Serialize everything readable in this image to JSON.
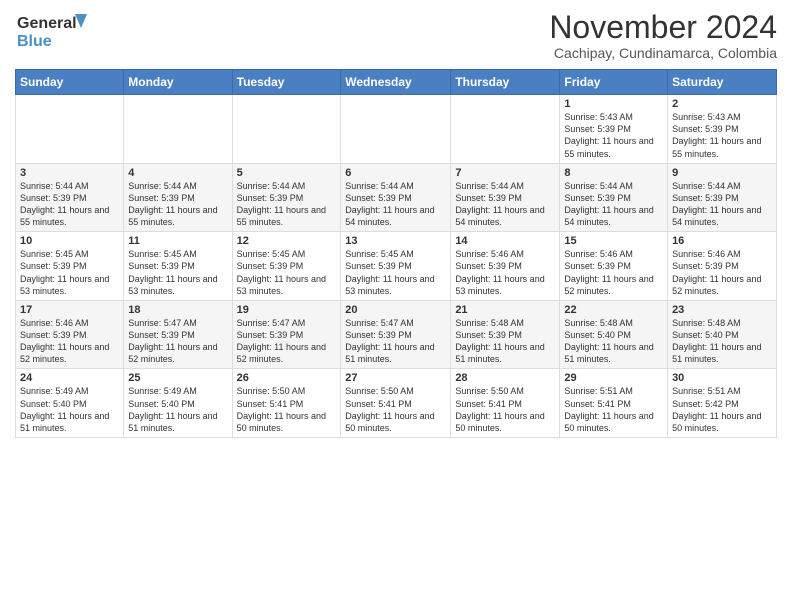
{
  "logo": {
    "line1": "General",
    "line2": "Blue"
  },
  "header": {
    "month": "November 2024",
    "location": "Cachipay, Cundinamarca, Colombia"
  },
  "weekdays": [
    "Sunday",
    "Monday",
    "Tuesday",
    "Wednesday",
    "Thursday",
    "Friday",
    "Saturday"
  ],
  "weeks": [
    [
      {
        "day": "",
        "info": ""
      },
      {
        "day": "",
        "info": ""
      },
      {
        "day": "",
        "info": ""
      },
      {
        "day": "",
        "info": ""
      },
      {
        "day": "",
        "info": ""
      },
      {
        "day": "1",
        "info": "Sunrise: 5:43 AM\nSunset: 5:39 PM\nDaylight: 11 hours and 55 minutes."
      },
      {
        "day": "2",
        "info": "Sunrise: 5:43 AM\nSunset: 5:39 PM\nDaylight: 11 hours and 55 minutes."
      }
    ],
    [
      {
        "day": "3",
        "info": "Sunrise: 5:44 AM\nSunset: 5:39 PM\nDaylight: 11 hours and 55 minutes."
      },
      {
        "day": "4",
        "info": "Sunrise: 5:44 AM\nSunset: 5:39 PM\nDaylight: 11 hours and 55 minutes."
      },
      {
        "day": "5",
        "info": "Sunrise: 5:44 AM\nSunset: 5:39 PM\nDaylight: 11 hours and 55 minutes."
      },
      {
        "day": "6",
        "info": "Sunrise: 5:44 AM\nSunset: 5:39 PM\nDaylight: 11 hours and 54 minutes."
      },
      {
        "day": "7",
        "info": "Sunrise: 5:44 AM\nSunset: 5:39 PM\nDaylight: 11 hours and 54 minutes."
      },
      {
        "day": "8",
        "info": "Sunrise: 5:44 AM\nSunset: 5:39 PM\nDaylight: 11 hours and 54 minutes."
      },
      {
        "day": "9",
        "info": "Sunrise: 5:44 AM\nSunset: 5:39 PM\nDaylight: 11 hours and 54 minutes."
      }
    ],
    [
      {
        "day": "10",
        "info": "Sunrise: 5:45 AM\nSunset: 5:39 PM\nDaylight: 11 hours and 53 minutes."
      },
      {
        "day": "11",
        "info": "Sunrise: 5:45 AM\nSunset: 5:39 PM\nDaylight: 11 hours and 53 minutes."
      },
      {
        "day": "12",
        "info": "Sunrise: 5:45 AM\nSunset: 5:39 PM\nDaylight: 11 hours and 53 minutes."
      },
      {
        "day": "13",
        "info": "Sunrise: 5:45 AM\nSunset: 5:39 PM\nDaylight: 11 hours and 53 minutes."
      },
      {
        "day": "14",
        "info": "Sunrise: 5:46 AM\nSunset: 5:39 PM\nDaylight: 11 hours and 53 minutes."
      },
      {
        "day": "15",
        "info": "Sunrise: 5:46 AM\nSunset: 5:39 PM\nDaylight: 11 hours and 52 minutes."
      },
      {
        "day": "16",
        "info": "Sunrise: 5:46 AM\nSunset: 5:39 PM\nDaylight: 11 hours and 52 minutes."
      }
    ],
    [
      {
        "day": "17",
        "info": "Sunrise: 5:46 AM\nSunset: 5:39 PM\nDaylight: 11 hours and 52 minutes."
      },
      {
        "day": "18",
        "info": "Sunrise: 5:47 AM\nSunset: 5:39 PM\nDaylight: 11 hours and 52 minutes."
      },
      {
        "day": "19",
        "info": "Sunrise: 5:47 AM\nSunset: 5:39 PM\nDaylight: 11 hours and 52 minutes."
      },
      {
        "day": "20",
        "info": "Sunrise: 5:47 AM\nSunset: 5:39 PM\nDaylight: 11 hours and 51 minutes."
      },
      {
        "day": "21",
        "info": "Sunrise: 5:48 AM\nSunset: 5:39 PM\nDaylight: 11 hours and 51 minutes."
      },
      {
        "day": "22",
        "info": "Sunrise: 5:48 AM\nSunset: 5:40 PM\nDaylight: 11 hours and 51 minutes."
      },
      {
        "day": "23",
        "info": "Sunrise: 5:48 AM\nSunset: 5:40 PM\nDaylight: 11 hours and 51 minutes."
      }
    ],
    [
      {
        "day": "24",
        "info": "Sunrise: 5:49 AM\nSunset: 5:40 PM\nDaylight: 11 hours and 51 minutes."
      },
      {
        "day": "25",
        "info": "Sunrise: 5:49 AM\nSunset: 5:40 PM\nDaylight: 11 hours and 51 minutes."
      },
      {
        "day": "26",
        "info": "Sunrise: 5:50 AM\nSunset: 5:41 PM\nDaylight: 11 hours and 50 minutes."
      },
      {
        "day": "27",
        "info": "Sunrise: 5:50 AM\nSunset: 5:41 PM\nDaylight: 11 hours and 50 minutes."
      },
      {
        "day": "28",
        "info": "Sunrise: 5:50 AM\nSunset: 5:41 PM\nDaylight: 11 hours and 50 minutes."
      },
      {
        "day": "29",
        "info": "Sunrise: 5:51 AM\nSunset: 5:41 PM\nDaylight: 11 hours and 50 minutes."
      },
      {
        "day": "30",
        "info": "Sunrise: 5:51 AM\nSunset: 5:42 PM\nDaylight: 11 hours and 50 minutes."
      }
    ]
  ]
}
